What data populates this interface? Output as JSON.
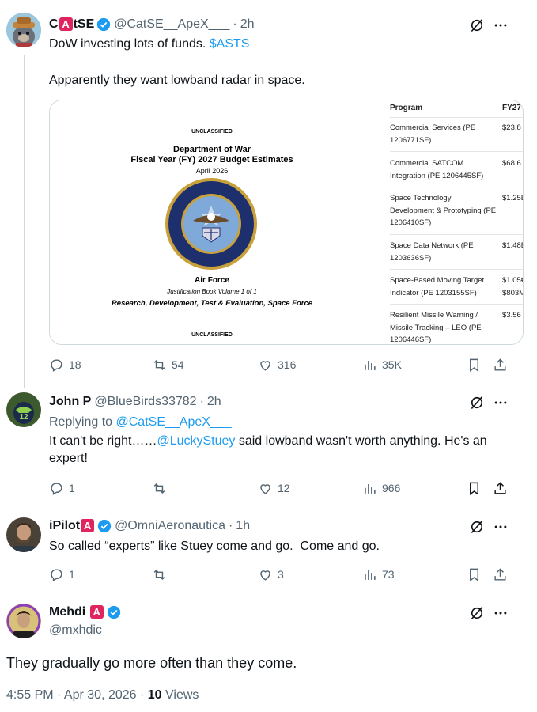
{
  "post1": {
    "name_pre": "C",
    "name_post": "tSE",
    "handle": "@CatSE__ApeX___",
    "time": "2h",
    "line1_pre": "DoW investing lots of funds. ",
    "line1_cashtag": "$ASTS",
    "line2": "Apparently they want lowband radar in space.",
    "doc": {
      "classification_top": "UNCLASSIFIED",
      "title1": "Department of War",
      "title2": "Fiscal Year (FY) 2027 Budget Estimates",
      "date": "April 2026",
      "branch": "Air Force",
      "book": "Justification Book Volume 1 of 1",
      "subtitle": "Research, Development, Test & Evaluation, Space Force",
      "classification_bottom": "UNCLASSIFIED"
    },
    "table": {
      "header_program": "Program",
      "header_fy": "FY27",
      "rows": [
        {
          "program": "Commercial Services (PE 1206771SF)",
          "value": "$23.8"
        },
        {
          "program": "Commercial SATCOM Integration (PE 1206445SF)",
          "value": "$68.6"
        },
        {
          "program": "Space Technology Development & Prototyping (PE 1206410SF)",
          "value": "$1.25E"
        },
        {
          "program": "Space Data Network (PE 1203636SF)",
          "value": "$1.48E"
        },
        {
          "program": "Space-Based Moving Target Indicator (PE 1203155SF)",
          "value": "$1.05€ $803M"
        },
        {
          "program": "Resilient Missile Warning / Missile Tracking – LEO (PE 1206446SF)",
          "value": "$3.56"
        }
      ]
    },
    "replies": "18",
    "reposts": "54",
    "likes": "316",
    "views": "35K"
  },
  "post2": {
    "name": "John P",
    "handle": "@BlueBirds33782",
    "time": "2h",
    "replying_label": "Replying to ",
    "replying_handle": "@CatSE__ApeX___",
    "text_pre": "It can't be right……",
    "text_mention": "@LuckyStuey",
    "text_post": " said lowband wasn't worth anything. He's an expert!",
    "replies": "1",
    "likes": "12",
    "views": "966"
  },
  "post3": {
    "name": "iPilot",
    "handle": "@OmniAeronautica",
    "time": "1h",
    "text": "So called “experts” like Stuey come and go.  Come and go.",
    "replies": "1",
    "likes": "3",
    "views": "73"
  },
  "post4": {
    "name": "Mehdi",
    "handle": "@mxhdic",
    "text": "They gradually go more often than they come.",
    "timestamp": "4:55 PM · Apr 30, 2026 · ",
    "views_count": "10",
    "views_label": " Views"
  },
  "icons": {
    "grok": "grok-icon",
    "more": "more-icon",
    "reply": "reply-icon",
    "repost": "repost-icon",
    "like": "like-icon",
    "views": "views-icon",
    "bookmark": "bookmark-icon",
    "share": "share-icon"
  },
  "colors": {
    "accent": "#1d9bf0",
    "badge": "#e0245e",
    "muted": "#536471"
  }
}
